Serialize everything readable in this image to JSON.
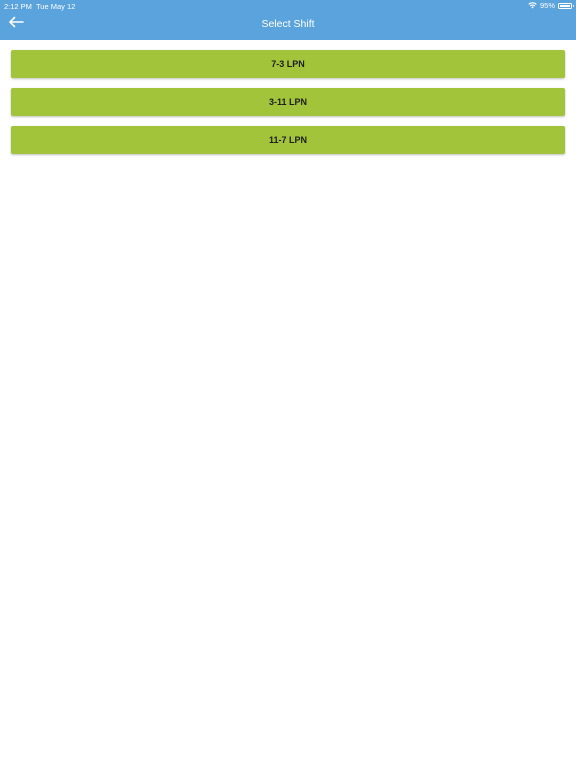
{
  "status_bar": {
    "time": "2:12 PM",
    "date": "Tue May 12",
    "battery": "95%",
    "battery_level": 0.95,
    "wifi_icon": "wifi-icon",
    "battery_icon": "battery-icon"
  },
  "header": {
    "title": "Select Shift",
    "back_icon": "back-arrow-icon",
    "background_color": "#5ba3dc"
  },
  "shifts": [
    {
      "label": "7-3 LPN"
    },
    {
      "label": "3-11 LPN"
    },
    {
      "label": "11-7 LPN"
    }
  ],
  "colors": {
    "shift_button": "#a2c43a",
    "header": "#5ba3dc"
  }
}
